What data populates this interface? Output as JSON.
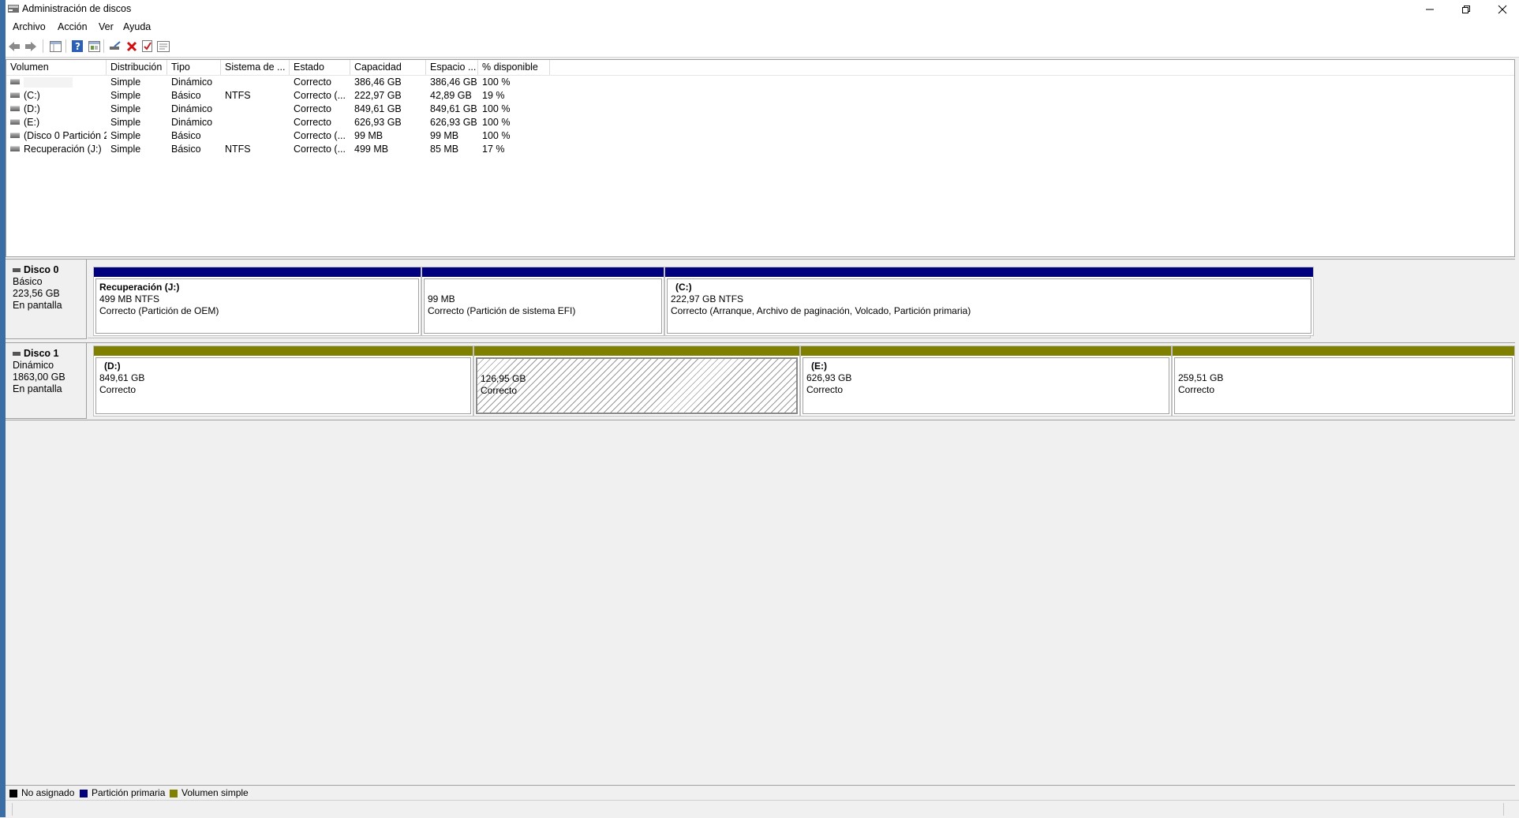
{
  "window": {
    "title": "Administración de discos"
  },
  "menu": [
    "Archivo",
    "Acción",
    "Ver",
    "Ayuda"
  ],
  "toolbar_icons": [
    "back-arrow-icon",
    "forward-arrow-icon",
    "disk-list-icon",
    "help-icon",
    "properties-icon",
    "connect-icon",
    "delete-icon",
    "check-icon",
    "settings-icon"
  ],
  "volume_list": {
    "columns": [
      "Volumen",
      "Distribución",
      "Tipo",
      "Sistema de ...",
      "Estado",
      "Capacidad",
      "Espacio ...",
      "% disponible"
    ],
    "rows": [
      [
        "",
        "Simple",
        "Dinámico",
        "",
        "Correcto",
        "386,46 GB",
        "386,46 GB",
        "100 %"
      ],
      [
        "(C:)",
        "Simple",
        "Básico",
        "NTFS",
        "Correcto (...",
        "222,97 GB",
        "42,89 GB",
        "19 %"
      ],
      [
        "(D:)",
        "Simple",
        "Dinámico",
        "",
        "Correcto",
        "849,61 GB",
        "849,61 GB",
        "100 %"
      ],
      [
        "(E:)",
        "Simple",
        "Dinámico",
        "",
        "Correcto",
        "626,93 GB",
        "626,93 GB",
        "100 %"
      ],
      [
        "(Disco 0 Partición 2)",
        "Simple",
        "Básico",
        "",
        "Correcto (...",
        "99 MB",
        "99 MB",
        "100 %"
      ],
      [
        "Recuperación (J:)",
        "Simple",
        "Básico",
        "NTFS",
        "Correcto (...",
        "499 MB",
        "85 MB",
        "17 %"
      ]
    ]
  },
  "disks": [
    {
      "name": "Disco 0",
      "type": "Básico",
      "size": "223,56 GB",
      "state": "En pantalla",
      "partitions": [
        {
          "name": "Recuperación  (J:)",
          "size": "499 MB NTFS",
          "status": "Correcto (Partición de OEM)"
        },
        {
          "name": "",
          "size": "99 MB",
          "status": "Correcto (Partición de sistema EFI)"
        },
        {
          "name": "(C:)",
          "size": "222,97 GB NTFS",
          "status": "Correcto (Arranque, Archivo de paginación, Volcado, Partición primaria)"
        }
      ]
    },
    {
      "name": "Disco 1",
      "type": "Dinámico",
      "size": "1863,00 GB",
      "state": "En pantalla",
      "partitions": [
        {
          "name": "(D:)",
          "size": "849,61 GB",
          "status": "Correcto"
        },
        {
          "name": "",
          "size": "126,95 GB",
          "status": "Correcto"
        },
        {
          "name": "(E:)",
          "size": "626,93 GB",
          "status": "Correcto"
        },
        {
          "name": "",
          "size": "259,51 GB",
          "status": "Correcto"
        }
      ]
    }
  ],
  "legend": [
    {
      "label": "No asignado",
      "color": "#000000"
    },
    {
      "label": "Partición primaria",
      "color": "#00007f"
    },
    {
      "label": "Volumen simple",
      "color": "#7f7f00"
    }
  ],
  "colors": {
    "primary_partition": "#00007f",
    "simple_volume": "#7f7f00",
    "unallocated": "#000000"
  }
}
